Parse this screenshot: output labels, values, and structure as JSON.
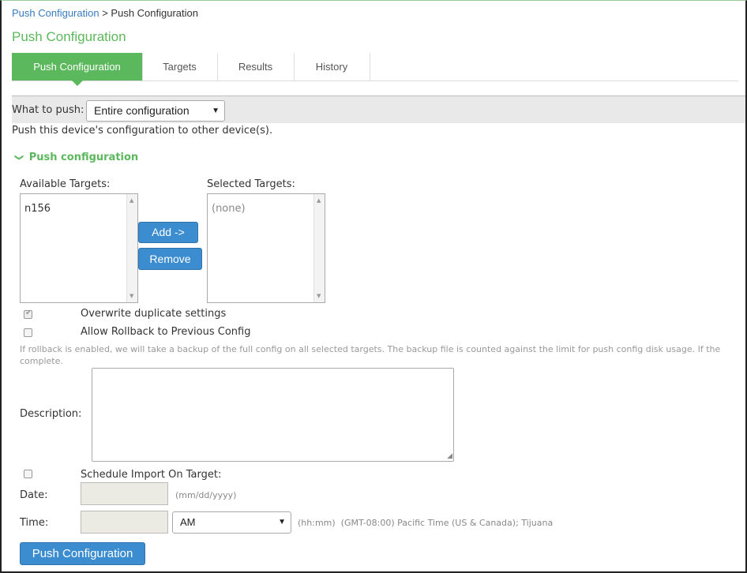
{
  "breadcrumb": {
    "parent": "Push Configuration",
    "separator": ">",
    "current": "Push Configuration"
  },
  "page": {
    "title": "Push Configuration"
  },
  "tabs": [
    {
      "label": "Push Configuration",
      "active": true
    },
    {
      "label": "Targets",
      "active": false
    },
    {
      "label": "Results",
      "active": false
    },
    {
      "label": "History",
      "active": false
    }
  ],
  "what_to_push": {
    "label": "What to push:",
    "value": "Entire configuration"
  },
  "intro_text": "Push this device's configuration to other device(s).",
  "section": {
    "chevron": "❯",
    "title": "Push configuration"
  },
  "available": {
    "label": "Available Targets:",
    "items": [
      "n156"
    ]
  },
  "selected": {
    "label": "Selected Targets:",
    "items": [
      "(none)"
    ]
  },
  "buttons": {
    "add": "Add ->",
    "remove": "Remove",
    "push": "Push Configuration"
  },
  "options": {
    "overwrite": {
      "label": "Overwrite duplicate settings",
      "checked": true
    },
    "rollback": {
      "label": "Allow Rollback to Previous Config",
      "checked": false
    }
  },
  "rollback_note_line1": "If rollback is enabled, we will take a backup of the full config on all selected targets. The backup file is counted against the limit for push config disk usage. If the",
  "rollback_note_line2": "complete.",
  "description": {
    "label": "Description:",
    "value": ""
  },
  "schedule": {
    "label": "Schedule Import On Target:",
    "checked": false,
    "date_label": "Date:",
    "date_hint": "(mm/dd/yyyy)",
    "time_label": "Time:",
    "ampm": "AM",
    "time_hint": "(hh:mm)",
    "timezone": "(GMT-08:00) Pacific Time (US & Canada); Tijuana"
  },
  "colors": {
    "accent": "#5cb85c",
    "button": "#3c8dcf",
    "link": "#3a7bbf"
  },
  "icons": {
    "chevron": "chevron-down-icon",
    "dropdown": "caret-down-icon",
    "check": "check-icon"
  }
}
